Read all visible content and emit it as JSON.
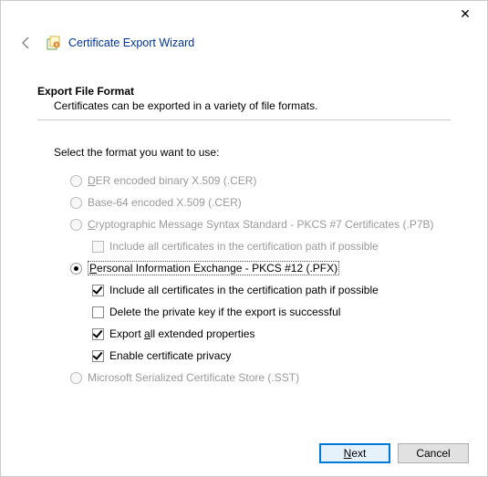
{
  "window": {
    "title": "Certificate Export Wizard"
  },
  "section": {
    "head": "Export File Format",
    "desc": "Certificates can be exported in a variety of file formats."
  },
  "prompt": "Select the format you want to use:",
  "options": {
    "der": "DER encoded binary X.509 (.CER)",
    "base64": "Base-64 encoded X.509 (.CER)",
    "p7b": "Cryptographic Message Syntax Standard - PKCS #7 Certificates (.P7B)",
    "p7b_include": "Include all certificates in the certification path if possible",
    "pfx": "Personal Information Exchange - PKCS #12 (.PFX)",
    "pfx_include": "Include all certificates in the certification path if possible",
    "pfx_delete": "Delete the private key if the export is successful",
    "pfx_ext": "Export all extended properties",
    "pfx_priv": "Enable certificate privacy",
    "sst": "Microsoft Serialized Certificate Store (.SST)"
  },
  "buttons": {
    "next": "Next",
    "cancel": "Cancel"
  }
}
